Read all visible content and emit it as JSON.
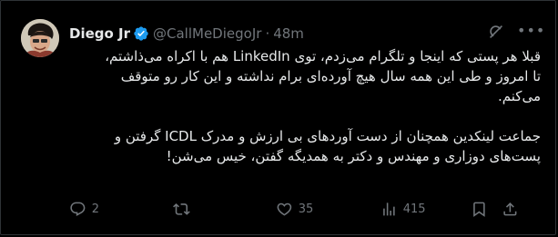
{
  "author": {
    "name": "Diego Jr",
    "handle": "@CallMeDiegoJr",
    "separator": "·",
    "time": "48m"
  },
  "tweet": {
    "paragraph1_line1": "قبلا هر پستی که اینجا و تلگرام می‌زدم، توی LinkedIn هم با اکراه می‌ذاشتم،",
    "paragraph1_line2": "تا امروز و طی این همه سال هیچ آورده‌ای برام نداشته و این کار رو متوقف",
    "paragraph1_line3": "می‌کنم.",
    "paragraph2_line1": "جماعت لینکدین همچنان از دست آوردهای بی ارزش و مدرک ICDL گرفتن و",
    "paragraph2_line2": "پست‌های دوزاری و مهندس و دکتر به همدیگه گفتن، خیس می‌شن!"
  },
  "actions": {
    "replies": "2",
    "retweets": "",
    "likes": "35",
    "views": "415"
  },
  "colors": {
    "background": "#000000",
    "text": "#e7e9ea",
    "muted": "#71767b",
    "verified": "#1d9bf0"
  },
  "icons": {
    "verified": "verified-badge-icon",
    "grok": "grok-icon",
    "more": "more-icon",
    "reply": "reply-icon",
    "retweet": "retweet-icon",
    "like": "like-icon",
    "views": "views-icon",
    "bookmark": "bookmark-icon",
    "share": "share-icon"
  }
}
